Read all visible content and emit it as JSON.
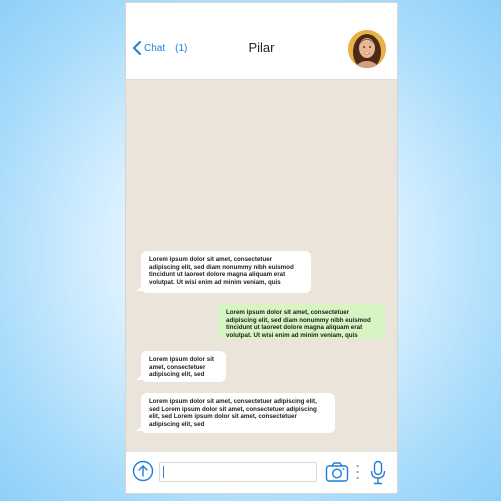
{
  "header": {
    "back_label": "Chat",
    "unread_count": "(1)",
    "contact_name": "Pilar",
    "avatar": "contact-avatar-photo"
  },
  "messages": [
    {
      "direction": "incoming",
      "text": "Lorem ipsum dolor sit amet, consectetuer adipiscing elit, sed diam nonummy nibh euismod tincidunt ut laoreet dolore magna aliquam erat volutpat. Ut wisi enim ad minim veniam, quis"
    },
    {
      "direction": "outgoing",
      "text": "Lorem ipsum dolor sit amet, consectetuer adipiscing elit, sed diam nonummy nibh euismod tincidunt ut laoreet dolore magna aliquam erat volutpat. Ut wisi enim ad minim veniam, quis"
    },
    {
      "direction": "incoming",
      "text": "Lorem ipsum dolor sit amet, consectetuer adipiscing elit, sed"
    },
    {
      "direction": "incoming",
      "text": "Lorem ipsum dolor sit amet, consectetuer adipiscing elit, sed Lorem ipsum dolor sit amet, consectetuer adipiscing elit, sed Lorem ipsum dolor sit amet, consectetuer adipiscing elit, sed"
    }
  ],
  "composer": {
    "input_value": "",
    "icons": [
      "upload-arrow-icon",
      "camera-icon",
      "more-dots-icon",
      "microphone-icon"
    ]
  },
  "colors": {
    "accent": "#1f7ed9",
    "chat_background": "#ebe4da",
    "incoming_bubble": "#ffffff",
    "outgoing_bubble": "#d6f5c2",
    "page_background": "#a9dcfb"
  }
}
